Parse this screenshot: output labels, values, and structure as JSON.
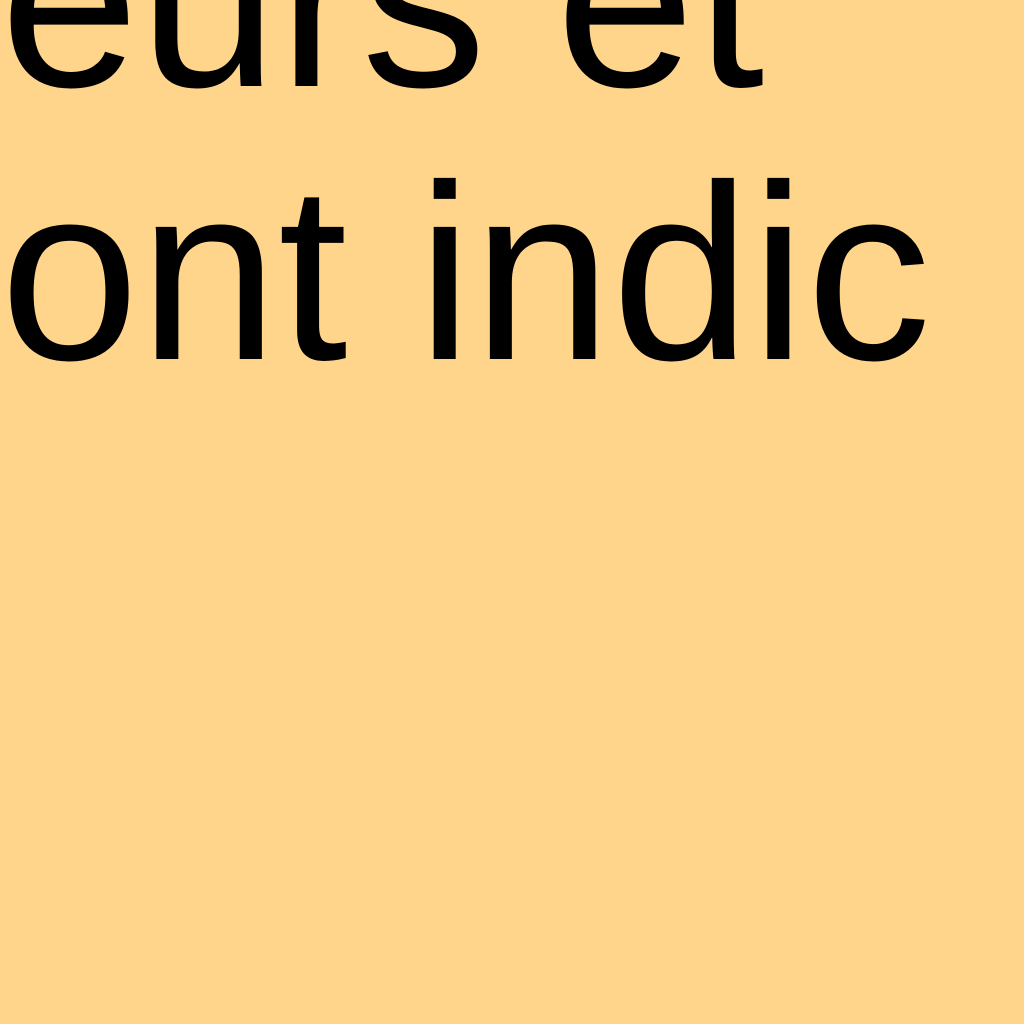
{
  "document": {
    "lines": [
      "eurs et",
      "ont indic"
    ]
  },
  "colors": {
    "background": "#FFD58C",
    "text": "#000000"
  }
}
